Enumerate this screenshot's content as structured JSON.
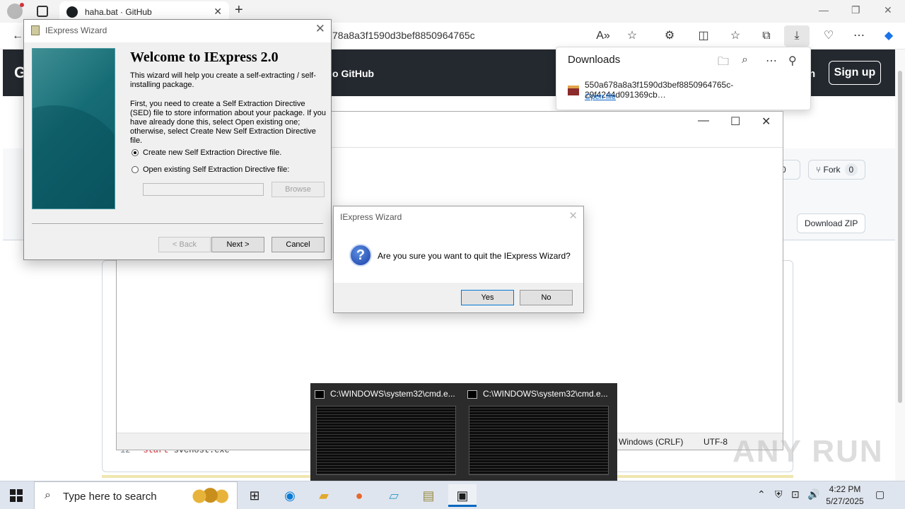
{
  "browser": {
    "tab_title": "haha.bat · GitHub",
    "url_visible": "78a8a3f1590d3bef8850964765c"
  },
  "github": {
    "logo_letter": "G",
    "header_link": "o GitHub",
    "sign_in": "n",
    "sign_up": "Sign up",
    "star_count": "0",
    "fork_label": "Fork",
    "fork_count": "0",
    "download_zip": "Download ZIP",
    "code_line_number": "12",
    "code_keyword": "start",
    "code_rest": "svchost.exe"
  },
  "downloads": {
    "title": "Downloads",
    "filename": "550a678a8a3f1590d3bef8850964765c-29f4244d091369cb…",
    "open_file": "Open file"
  },
  "notepad": {
    "status_eol": "Windows (CRLF)",
    "status_enc": "UTF-8"
  },
  "wizard": {
    "title": "IExpress Wizard",
    "heading": "Welcome to IExpress 2.0",
    "para1": "This wizard will help you create a self-extracting / self-installing package.",
    "para2": "First, you need to create a Self Extraction Directive (SED) file to store information about your package.  If you have already done this, select Open existing one; otherwise, select Create New Self Extraction Directive file.",
    "option_new": "Create new Self Extraction Directive file.",
    "option_open": "Open existing Self Extraction Directive file:",
    "browse": "Browse",
    "back": "< Back",
    "next": "Next >",
    "cancel": "Cancel"
  },
  "confirm": {
    "title": "IExpress Wizard",
    "message": "Are you sure you want to quit the IExpress Wizard?",
    "yes": "Yes",
    "no": "No"
  },
  "preview": {
    "window1_title": "C:\\WINDOWS\\system32\\cmd.e...",
    "window2_title": "C:\\WINDOWS\\system32\\cmd.e..."
  },
  "watermark": "ANY RUN",
  "taskbar": {
    "search_placeholder": "Type here to search",
    "time": "4:22 PM",
    "date": "5/27/2025"
  }
}
